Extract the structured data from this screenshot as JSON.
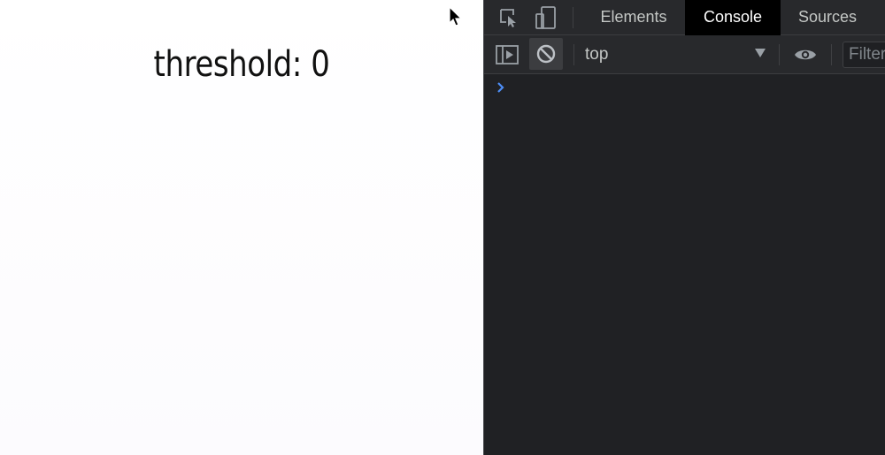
{
  "page": {
    "title": "threshold: 0"
  },
  "devtools": {
    "tabs": [
      {
        "label": "Elements",
        "active": false
      },
      {
        "label": "Console",
        "active": true
      },
      {
        "label": "Sources",
        "active": false
      }
    ],
    "toolbar": {
      "context": "top",
      "filter_placeholder": "Filter"
    },
    "colors": {
      "panel_bg": "#202124",
      "toolbar_bg": "#28292c",
      "active_tab_bg": "#000000",
      "prompt_accent": "#4d8ef7"
    }
  }
}
